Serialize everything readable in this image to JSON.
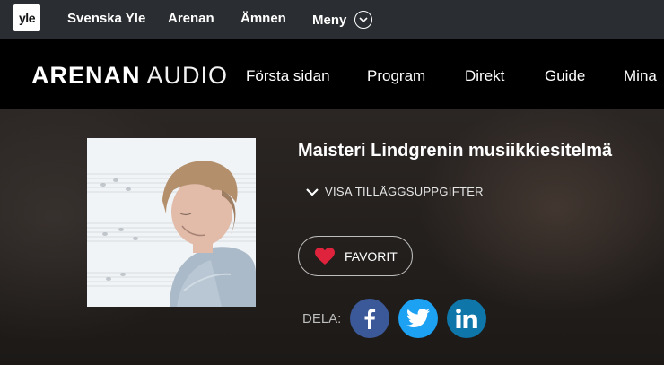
{
  "ylebar": {
    "logo": "yle",
    "nav": [
      "Svenska Yle",
      "Arenan",
      "Ämnen",
      "Meny"
    ]
  },
  "arenanbar": {
    "brand_bold": "ARENAN",
    "brand_light": "AUDIO",
    "nav": [
      "Första sidan",
      "Program",
      "Direkt",
      "Guide",
      "Mina"
    ]
  },
  "hero": {
    "title": "Maisteri Lindgrenin musiikkiesitelmä",
    "more_info": "VISA TILLÄGGSUPPGIFTER",
    "favorite": "FAVORIT",
    "share_label": "DELA:",
    "share_icons": [
      "facebook-icon",
      "twitter-icon",
      "linkedin-icon"
    ]
  },
  "colors": {
    "topbar": "#2a2d31",
    "header": "#000000",
    "heart": "#e0233c",
    "facebook": "#3b5998",
    "twitter": "#1da1f2",
    "linkedin": "#0e76a8"
  }
}
